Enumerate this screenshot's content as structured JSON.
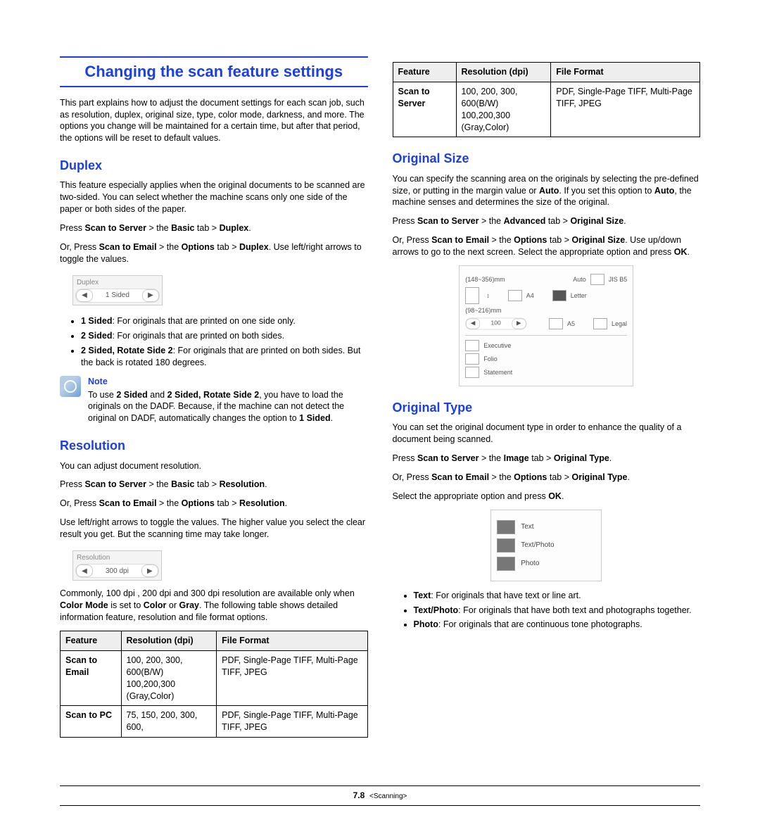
{
  "title": "Changing the scan feature settings",
  "intro": "This part explains how to adjust the document settings for each scan job, such as resolution, duplex, original size, type, color mode, darkness, and more. The options you change will be maintained for a certain time, but after that period, the options will be reset to default values.",
  "duplex": {
    "heading": "Duplex",
    "p1": "This feature especially applies when the original documents to be scanned are two-sided. You can select whether the machine scans only one side of the paper or both sides of the paper.",
    "press_pre": "Press ",
    "press_b1": "Scan to Server",
    "press_mid1": " > the ",
    "press_b2": "Basic",
    "press_mid2": " tab > ",
    "press_b3": "Duplex",
    "press_end": ".",
    "or_pre": "Or, Press ",
    "or_b1": "Scan to Email",
    "or_mid1": " > the ",
    "or_b2": "Options",
    "or_mid2": " tab > ",
    "or_b3": "Duplex",
    "or_end": ". Use left/right arrows to toggle the values.",
    "widget_label": "Duplex",
    "widget_value": "1 Sided",
    "b1_b": "1 Sided",
    "b1_t": ": For originals that are printed on one side only.",
    "b2_b": "2 Sided",
    "b2_t": ": For originals that are printed on both sides.",
    "b3_b": "2 Sided, Rotate Side 2",
    "b3_t": ": For originals that are printed on both sides. But the back is rotated 180 degrees.",
    "note_title": "Note",
    "note_pre": "To use ",
    "note_b1": "2 Sided",
    "note_mid1": " and ",
    "note_b2": "2 Sided, Rotate Side 2",
    "note_mid2": ", you have to load the originals on the DADF. Because, if the machine can not detect the original on DADF, automatically changes the option to ",
    "note_b3": "1 Sided",
    "note_end": "."
  },
  "resolution": {
    "heading": "Resolution",
    "p1": "You can adjust document resolution.",
    "press_pre": "Press ",
    "press_b1": "Scan to Server",
    "press_mid1": " > the ",
    "press_b2": "Basic",
    "press_mid2": " tab > ",
    "press_b3": "Resolution",
    "press_end": ".",
    "or_pre": "Or, Press ",
    "or_b1": "Scan to Email",
    "or_mid1": " > the ",
    "or_b2": "Options",
    "or_mid2": " tab > ",
    "or_b3": "Resolution",
    "or_end": ".",
    "p2": "Use left/right arrows to toggle the values. The higher value you select the clear result you get. But the scanning time may take longer.",
    "widget_label": "Resolution",
    "widget_value": "300 dpi",
    "p3_pre": "Commonly, 100 dpi , 200 dpi and 300 dpi resolution are available only when ",
    "p3_b1": "Color Mode",
    "p3_mid": " is set to ",
    "p3_b2": "Color",
    "p3_mid2": " or ",
    "p3_b3": "Gray",
    "p3_end": ". The following table shows detailed information feature, resolution and file format options."
  },
  "table1": {
    "h1": "Feature",
    "h2": "Resolution (dpi)",
    "h3": "File Format",
    "rows": [
      {
        "f": "Scan to Email",
        "r": "100, 200, 300, 600(B/W)\n100,200,300 (Gray,Color)",
        "ff": "PDF, Single-Page TIFF, Multi-Page TIFF, JPEG"
      },
      {
        "f": "Scan to PC",
        "r": "75, 150, 200, 300, 600,",
        "ff": "PDF, Single-Page TIFF, Multi-Page TIFF, JPEG"
      }
    ]
  },
  "table2": {
    "h1": "Feature",
    "h2": "Resolution (dpi)",
    "h3": "File Format",
    "rows": [
      {
        "f": "Scan to Server",
        "r": "100, 200, 300, 600(B/W)\n100,200,300 (Gray,Color)",
        "ff": "PDF, Single-Page TIFF, Multi-Page TIFF, JPEG"
      }
    ]
  },
  "orig_size": {
    "heading": "Original Size",
    "p1_pre": "You can specify the scanning area on the originals by selecting the pre-defined size, or putting in the margin value or ",
    "p1_b1": "Auto",
    "p1_mid": ". If you set this option to ",
    "p1_b2": "Auto",
    "p1_end": ", the machine senses and determines the size of the original.",
    "press_pre": "Press ",
    "press_b1": "Scan to Server",
    "press_mid1": " > the ",
    "press_b2": "Advanced",
    "press_mid2": " tab > ",
    "press_b3": "Original Size",
    "press_end": ".",
    "or_pre": "Or, Press ",
    "or_b1": "Scan to Email",
    "or_mid1": " > the ",
    "or_b2": "Options",
    "or_mid2": " tab > ",
    "or_b3": "Original Size",
    "or_mid3": ". Use up/down arrows to go to the next screen. Select the appropriate option and press ",
    "or_b4": "OK",
    "or_end": ".",
    "labels": [
      "(148~356)mm",
      "A4",
      "Letter",
      "(98~216)mm",
      "A5",
      "Legal",
      "Executive",
      "Folio",
      "Statement"
    ],
    "stepper": "100"
  },
  "orig_type": {
    "heading": "Original Type",
    "p1": "You can set the original document type in order to enhance the quality of a document being scanned.",
    "press_pre": "Press ",
    "press_b1": "Scan to Server",
    "press_mid1": " > the ",
    "press_b2": "Image",
    "press_mid2": " tab > ",
    "press_b3": "Original Type",
    "press_end": ".",
    "or_pre": "Or, Press ",
    "or_b1": "Scan to Email",
    "or_mid1": " > the ",
    "or_b2": "Options",
    "or_mid2": " tab > ",
    "or_b3": "Original Type",
    "or_end": ".",
    "sel_pre": "Select the appropriate option and press ",
    "sel_b": "OK",
    "sel_end": ".",
    "opts": [
      "Text",
      "Text/Photo",
      "Photo"
    ],
    "b1_b": "Text",
    "b1_t": ": For originals that have text or line art.",
    "b2_b": "Text/Photo",
    "b2_t": ": For originals that have both text and photographs together.",
    "b3_b": "Photo",
    "b3_t": ": For originals that are continuous tone photographs."
  },
  "footer": {
    "page": "7.8",
    "section": "<Scanning>"
  }
}
